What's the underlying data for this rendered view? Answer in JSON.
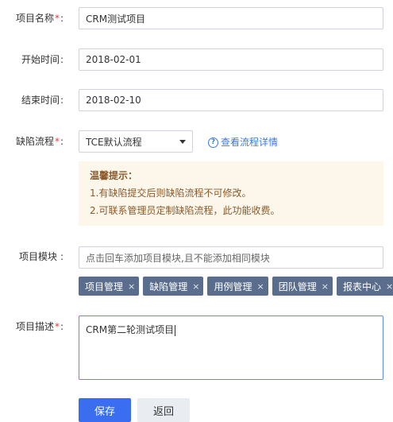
{
  "form": {
    "name": {
      "label": "项目名称",
      "required": "*",
      "colon": ":",
      "value": "CRM测试项目"
    },
    "start": {
      "label": "开始时间",
      "colon": ":",
      "value": "2018-02-01"
    },
    "end": {
      "label": "结束时间",
      "colon": ":",
      "value": "2018-02-10"
    },
    "flow": {
      "label": "缺陷流程",
      "required": "*",
      "colon": ":",
      "value": "TCE默认流程",
      "detail_link": "查看流程详情"
    },
    "tip": {
      "title": "温馨提示：",
      "lines": [
        "1.有缺陷提交后则缺陷流程不可修改。",
        "2.可联系管理员定制缺陷流程，此功能收费。"
      ]
    },
    "module": {
      "label": "项目模块",
      "colon": ":",
      "placeholder": "点击回车添加项目模块,且不能添加相同模块",
      "tags": [
        "项目管理",
        "缺陷管理",
        "用例管理",
        "团队管理",
        "报表中心"
      ],
      "tag_close": "×"
    },
    "desc": {
      "label": "项目描述",
      "required": "*",
      "colon": ":",
      "value": "CRM第二轮测试项目"
    }
  },
  "actions": {
    "save": "保存",
    "back": "返回"
  },
  "colors": {
    "primary": "#3a6df0",
    "tag": "#5a6d8c",
    "tip_bg": "#fdf6ea",
    "link": "#3a78e0",
    "required": "#e4393c"
  }
}
